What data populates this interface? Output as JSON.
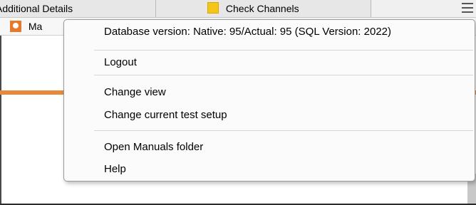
{
  "background": {
    "tabs": [
      {
        "label": "Additional Details"
      },
      {
        "label": "Check Channels"
      }
    ],
    "subtab": {
      "label": "Ma"
    },
    "accent_color": "#e8883a"
  },
  "menu": {
    "items": [
      {
        "label": "Database version: Native: 95/Actual: 95 (SQL Version: 2022)"
      },
      {
        "label": "Logout"
      },
      {
        "label": "Change view"
      },
      {
        "label": "Change current test setup"
      },
      {
        "label": "Open Manuals folder"
      },
      {
        "label": "Help"
      }
    ]
  }
}
